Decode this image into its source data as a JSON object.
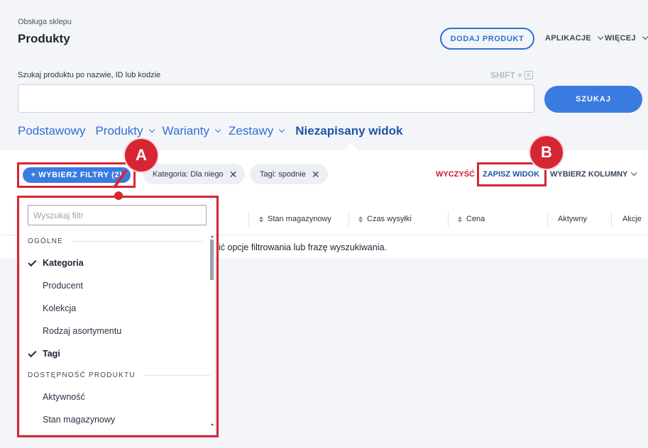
{
  "header": {
    "breadcrumb": "Obsługa sklepu",
    "title": "Produkty",
    "add_product": "DODAJ PRODUKT",
    "apps": "APLIKACJE",
    "more": "WIĘCEJ"
  },
  "search": {
    "label": "Szukaj produktu po nazwie, ID lub kodzie",
    "shortcut_text": "SHIFT +",
    "shortcut_key": "F",
    "value": "",
    "button": "SZUKAJ"
  },
  "views": {
    "basic": "Podstawowy",
    "products": "Produkty",
    "variants": "Warianty",
    "sets": "Zestawy",
    "unsaved": "Niezapisany widok"
  },
  "filterbar": {
    "choose_filters": "+ WYBIERZ FILTRY (2)",
    "chips": [
      {
        "label": "Kategoria: Dla niego"
      },
      {
        "label": "Tagi: spodnie"
      }
    ],
    "clear": "WYCZYŚĆ",
    "save_view": "ZAPISZ WIDOK",
    "choose_columns": "WYBIERZ KOLUMNY"
  },
  "table": {
    "columns": [
      "Stan magazynowy",
      "Czas wysyłki",
      "Cena",
      "Aktywny",
      "Akcje"
    ],
    "empty_message": "ić opcje filtrowania lub frazę wyszukiwania."
  },
  "dropdown": {
    "search_placeholder": "Wyszukaj filtr",
    "section_general": "OGÓLNE",
    "items_general": [
      {
        "label": "Kategoria",
        "checked": true
      },
      {
        "label": "Producent",
        "checked": false
      },
      {
        "label": "Kolekcja",
        "checked": false
      },
      {
        "label": "Rodzaj asortymentu",
        "checked": false
      },
      {
        "label": "Tagi",
        "checked": true
      }
    ],
    "section_availability": "DOSTĘPNOŚĆ PRODUKTU",
    "items_availability": [
      {
        "label": "Aktywność",
        "checked": false
      },
      {
        "label": "Stan magazynowy",
        "checked": false
      }
    ]
  },
  "annotations": {
    "a": "A",
    "b": "B",
    "color": "#d62634"
  },
  "colors": {
    "accent": "#3a7be0",
    "link": "#1e55a8",
    "danger": "#d0173a"
  }
}
